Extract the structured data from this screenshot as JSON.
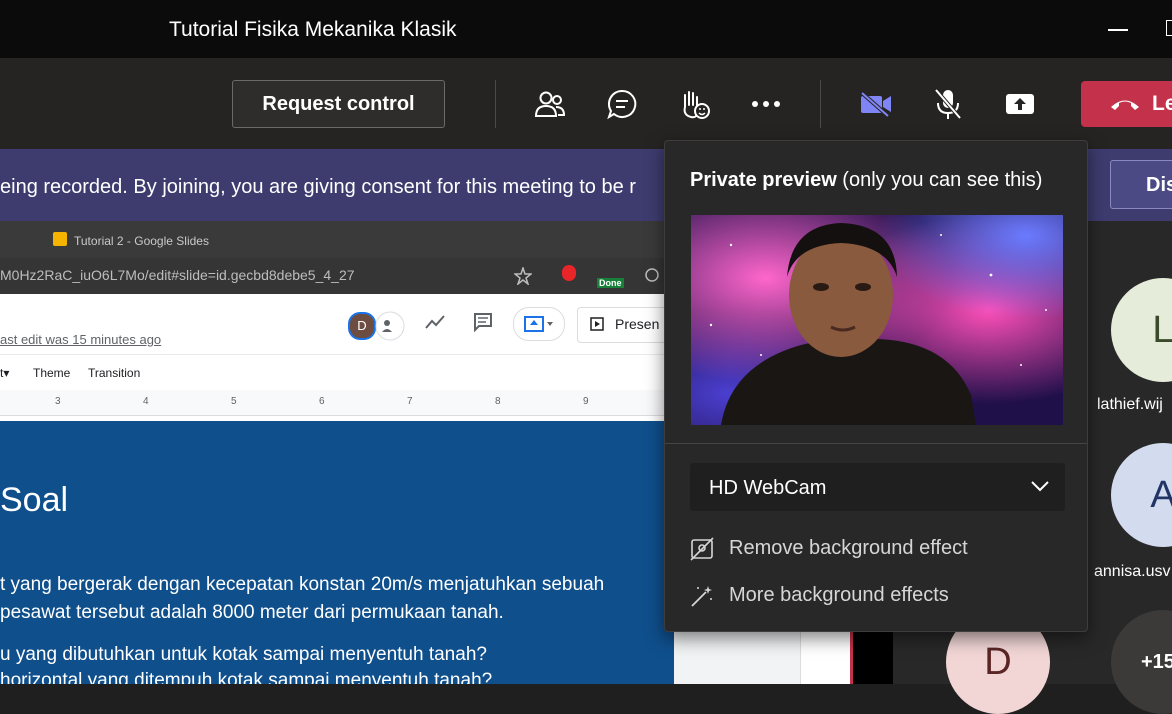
{
  "window": {
    "title": "Tutorial Fisika Mekanika Klasik"
  },
  "toolbar": {
    "request_control": "Request control",
    "leave": "Leave"
  },
  "banner": {
    "text": "eing recorded. By joining, you are giving consent for this meeting to be r",
    "dismiss": "Dis"
  },
  "shared": {
    "tab_title": "Tutorial 2 - Google Slides",
    "url": "M0Hz2RaC_iuO6L7Mo/edit#slide=id.gecbd8debe5_4_27",
    "ext_badge": "Done",
    "last_edit": "ast edit was 15 minutes ago",
    "avatar": "D",
    "present": "Presen",
    "menu": [
      "t▾",
      "Theme",
      "Transition"
    ],
    "ruler": [
      "3",
      "4",
      "5",
      "6",
      "7",
      "8",
      "9"
    ],
    "slide_title": "Soal",
    "lines": [
      "t yang bergerak dengan kecepatan konstan 20m/s menjatuhkan sebuah",
      "pesawat tersebut adalah 8000 meter dari permukaan tanah.",
      "u yang dibutuhkan untuk kotak sampai menyentuh tanah?",
      "horizontal yang ditempuh kotak sampai menyentuh tanah?"
    ]
  },
  "preview": {
    "title_bold": "Private preview",
    "title_rest": " (only you can see this)",
    "device": "HD WebCam",
    "effects": [
      "Remove background effect",
      "More background effects"
    ]
  },
  "participants": [
    {
      "initial": "L",
      "name": "lathief.wij"
    },
    {
      "initial": "A",
      "name": "annisa.usv"
    },
    {
      "initial": "D",
      "name": ""
    },
    {
      "initial": "+15",
      "name": ""
    }
  ],
  "colors": {
    "leave": "#c4314b",
    "banner": "#3e3c6f",
    "camera_on": "#7f85f5"
  }
}
